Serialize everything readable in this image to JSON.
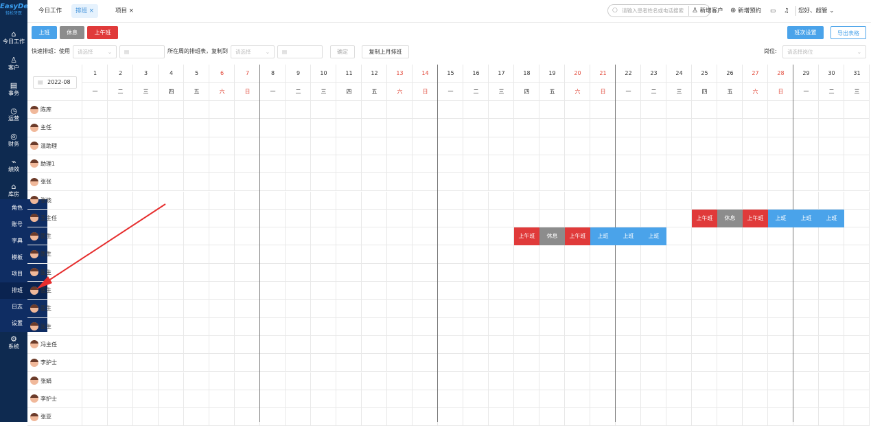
{
  "app": {
    "logo": "EasyDent",
    "logo_sub": "轻松牙医"
  },
  "sidebar": {
    "items": [
      {
        "icon": "home-icon",
        "label": "今日工作"
      },
      {
        "icon": "user-icon",
        "label": "客户"
      },
      {
        "icon": "task-icon",
        "label": "事务"
      },
      {
        "icon": "clock-icon",
        "label": "运营"
      },
      {
        "icon": "wallet-icon",
        "label": "财务"
      },
      {
        "icon": "chart-icon",
        "label": "绩效"
      },
      {
        "icon": "warehouse-icon",
        "label": "库房"
      },
      {
        "icon": "settings-icon",
        "label": "系统"
      }
    ]
  },
  "submenu": {
    "items": [
      {
        "label": "角色"
      },
      {
        "label": "账号"
      },
      {
        "label": "字典"
      },
      {
        "label": "模板"
      },
      {
        "label": "项目"
      },
      {
        "label": "排班",
        "active": true
      },
      {
        "label": "日志"
      },
      {
        "label": "设置"
      }
    ]
  },
  "tabs": [
    {
      "label": "今日工作",
      "closable": false,
      "active": false
    },
    {
      "label": "排班",
      "closable": true,
      "active": true
    },
    {
      "label": "项目",
      "closable": true,
      "active": false
    }
  ],
  "topbar": {
    "search_placeholder": "请输入患者姓名或电话搜索",
    "new_customer": "新增客户",
    "new_appointment": "新增预约",
    "greeting": "您好、超管"
  },
  "toolbar": {
    "shift_buttons": [
      "上班",
      "休息",
      "上午班"
    ],
    "shift_settings": "班次设置",
    "export": "导出表格",
    "quick_label": "快速排班：使用",
    "select_placeholder": "请选择",
    "copy_to_label": "所在周的排班表，复制到",
    "select_placeholder2": "请选择",
    "confirm": "确定",
    "copy_last_month": "复制上月排班",
    "position_label": "岗位:",
    "position_placeholder": "请选择岗位"
  },
  "calendar": {
    "month": "2022-08",
    "days": [
      "1",
      "2",
      "3",
      "4",
      "5",
      "6",
      "7",
      "8",
      "9",
      "10",
      "11",
      "12",
      "13",
      "14",
      "15",
      "16",
      "17",
      "18",
      "19",
      "20",
      "21",
      "22",
      "23",
      "24",
      "25",
      "26",
      "27",
      "28",
      "29",
      "30",
      "31"
    ],
    "weekdays": [
      "一",
      "二",
      "三",
      "四",
      "五",
      "六",
      "日",
      "一",
      "二",
      "三",
      "四",
      "五",
      "六",
      "日",
      "一",
      "二",
      "三",
      "四",
      "五",
      "六",
      "日",
      "一",
      "二",
      "三",
      "四",
      "五",
      "六",
      "日",
      "一",
      "二",
      "三"
    ]
  },
  "staff": [
    "陈库",
    "主任",
    "温助理",
    "助理1",
    "张张",
    "张娆",
    "王主任",
    "医生",
    "医生",
    "医生",
    "医生",
    "医生",
    "医生",
    "冯主任",
    "李护士",
    "张娟",
    "李护士",
    "张亚"
  ],
  "shifts": [
    {
      "row": 6,
      "day": 25,
      "label": "上午班",
      "type": "red"
    },
    {
      "row": 6,
      "day": 26,
      "label": "休息",
      "type": "grey"
    },
    {
      "row": 6,
      "day": 27,
      "label": "上午班",
      "type": "red"
    },
    {
      "row": 6,
      "day": 28,
      "label": "上班",
      "type": "blue"
    },
    {
      "row": 6,
      "day": 29,
      "label": "上班",
      "type": "blue"
    },
    {
      "row": 6,
      "day": 30,
      "label": "上班",
      "type": "blue"
    },
    {
      "row": 7,
      "day": 18,
      "label": "上午班",
      "type": "red"
    },
    {
      "row": 7,
      "day": 19,
      "label": "休息",
      "type": "grey"
    },
    {
      "row": 7,
      "day": 20,
      "label": "上午班",
      "type": "red"
    },
    {
      "row": 7,
      "day": 21,
      "label": "上班",
      "type": "blue"
    },
    {
      "row": 7,
      "day": 22,
      "label": "上班",
      "type": "blue"
    },
    {
      "row": 7,
      "day": 23,
      "label": "上班",
      "type": "blue"
    }
  ],
  "colors": {
    "blue": "#4aa3ea",
    "grey": "#8c8c8c",
    "red": "#e03a3a",
    "sidebar": "#0e2a50",
    "weekend": "#e24a3b"
  }
}
